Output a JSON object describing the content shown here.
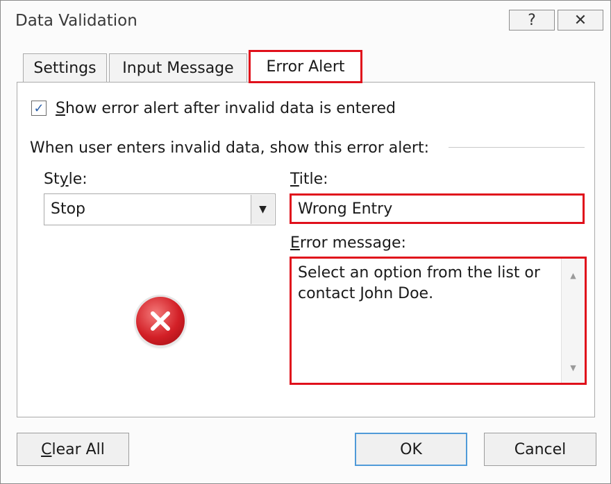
{
  "window": {
    "title": "Data Validation",
    "help_label": "?",
    "close_label": "✕"
  },
  "tabs": [
    {
      "label": "Settings",
      "active": false
    },
    {
      "label": "Input Message",
      "active": false
    },
    {
      "label": "Error Alert",
      "active": true
    }
  ],
  "error_alert": {
    "show_alert_checked": true,
    "show_alert_label_first": "S",
    "show_alert_label_rest": "how error alert after invalid data is entered",
    "group_label": "When user enters invalid data, show this error alert:",
    "style_label_first": "St",
    "style_label_underlined": "y",
    "style_label_rest": "le:",
    "style_value": "Stop",
    "title_label_first": "T",
    "title_label_rest": "itle:",
    "title_value": "Wrong Entry",
    "message_label_first": "E",
    "message_label_rest": "rror message:",
    "message_value": "Select an option from the list or contact John Doe."
  },
  "buttons": {
    "clear_all_first": "C",
    "clear_all_rest": "lear All",
    "ok": "OK",
    "cancel": "Cancel"
  },
  "icons": {
    "checkbox": "check-mark-icon",
    "style_icon": "stop-error-icon",
    "dropdown": "dropdown-arrow-icon",
    "scroll_up": "scroll-up-arrow-icon",
    "scroll_down": "scroll-down-arrow-icon"
  },
  "colors": {
    "highlight": "#e0101b",
    "stop_icon": "#d21f26",
    "ok_border": "#4f9ad8"
  }
}
